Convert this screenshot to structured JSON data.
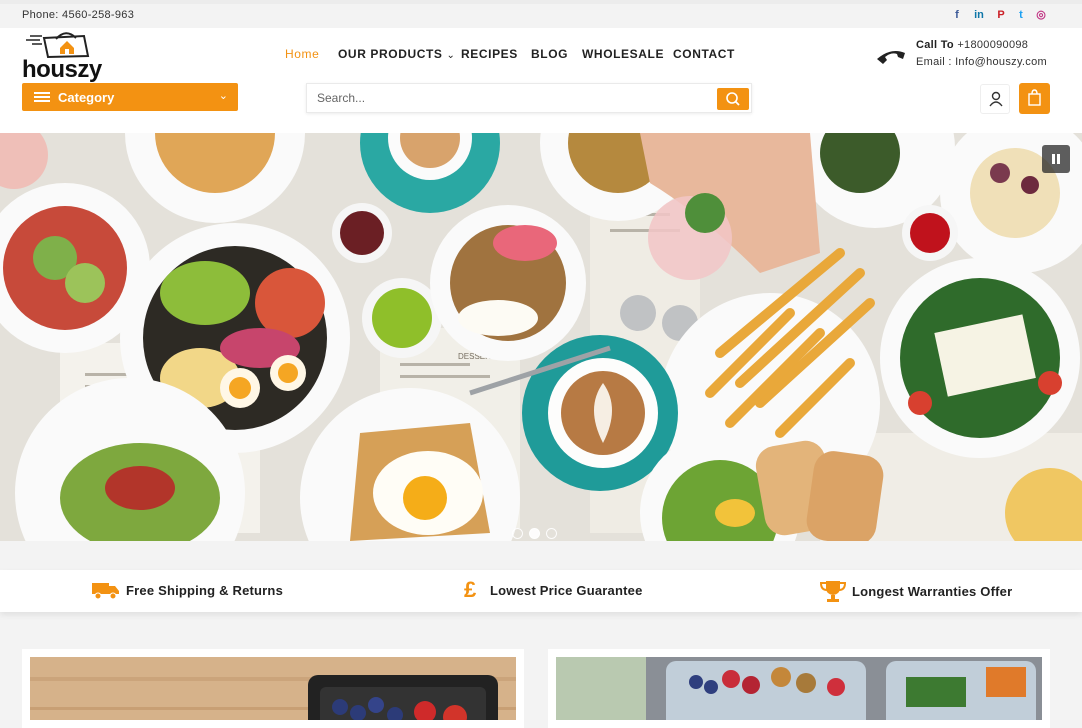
{
  "topbar": {
    "phone": "Phone: 4560-258-963",
    "social": [
      {
        "name": "facebook-icon",
        "glyph": "f",
        "color": "#3b5998"
      },
      {
        "name": "linkedin-icon",
        "glyph": "in",
        "color": "#0e76a8"
      },
      {
        "name": "pinterest-icon",
        "glyph": "P",
        "color": "#cb2027"
      },
      {
        "name": "twitter-icon",
        "glyph": "t",
        "color": "#1da1f2"
      },
      {
        "name": "instagram-icon",
        "glyph": "◎",
        "color": "#c13584"
      }
    ]
  },
  "brand": {
    "logo_text": "houszy",
    "accent": "#f39212"
  },
  "category": {
    "label": "Category"
  },
  "nav": {
    "items": [
      {
        "label": "Home",
        "active": true
      },
      {
        "label": "OUR PRODUCTS",
        "dropdown": true
      },
      {
        "label": "RECIPES"
      },
      {
        "label": "BLOG"
      },
      {
        "label": "WHOLESALE"
      },
      {
        "label": "CONTACT"
      }
    ]
  },
  "search": {
    "placeholder": "Search...",
    "value": ""
  },
  "contact": {
    "call_label": "Call To",
    "phone": "+1800090098",
    "email_line": "Email : Info@houszy.com"
  },
  "hero": {
    "menu_text": "DESSERT $9",
    "slides": 3,
    "active_slide": 2
  },
  "features": [
    {
      "icon": "truck-icon",
      "label": "Free Shipping & Returns"
    },
    {
      "icon": "pound-icon",
      "label": "Lowest Price Guarantee"
    },
    {
      "icon": "trophy-icon",
      "label": "Longest Warranties Offer"
    }
  ]
}
